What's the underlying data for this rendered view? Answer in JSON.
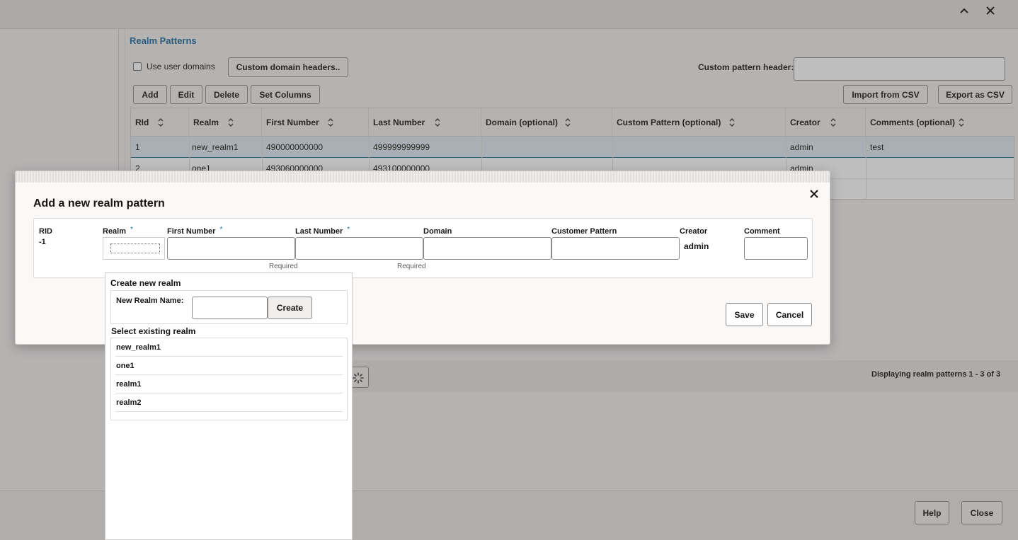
{
  "window": {
    "collapse_icon": "chevron-up-icon",
    "close_icon": "close-icon"
  },
  "panel": {
    "title": "Realm Patterns",
    "use_user_domains_label": "Use user domains",
    "custom_domain_headers_label": "Custom domain headers..",
    "custom_pattern_header_label": "Custom pattern header:",
    "custom_pattern_header_value": ""
  },
  "toolbar": {
    "add": "Add",
    "edit": "Edit",
    "delete": "Delete",
    "set_columns": "Set Columns",
    "import_csv": "Import from CSV",
    "export_csv": "Export as CSV"
  },
  "table": {
    "columns": [
      "RId",
      "Realm",
      "First Number",
      "Last Number",
      "Domain (optional)",
      "Custom Pattern (optional)",
      "Creator",
      "Comments (optional)"
    ],
    "rows": [
      {
        "rid": "1",
        "realm": "new_realm1",
        "first": "490000000000",
        "last": "499999999999",
        "domain": "",
        "pattern": "",
        "creator": "admin",
        "comments": "test"
      },
      {
        "rid": "2",
        "realm": "one1",
        "first": "493060000000",
        "last": "493100000000",
        "domain": "",
        "pattern": "",
        "creator": "admin",
        "comments": ""
      }
    ],
    "status": "Displaying realm patterns 1 - 3 of 3"
  },
  "bottom": {
    "help": "Help",
    "close": "Close"
  },
  "dialog": {
    "title": "Add a new realm pattern",
    "labels": {
      "rid": "RID",
      "realm": "Realm",
      "first": "First Number",
      "last": "Last Number",
      "domain": "Domain",
      "customer_pattern": "Customer Pattern",
      "creator": "Creator",
      "comment": "Comment"
    },
    "required_star": "*",
    "rid_value": "-1",
    "creator_value": "admin",
    "required_text": "Required",
    "save": "Save",
    "cancel": "Cancel"
  },
  "realm_popup": {
    "create_heading": "Create new realm",
    "new_realm_name_label": "New Realm Name:",
    "new_realm_name_value": "",
    "create_button": "Create",
    "select_heading": "Select existing realm",
    "realms": [
      "new_realm1",
      "one1",
      "realm1",
      "realm2"
    ]
  }
}
